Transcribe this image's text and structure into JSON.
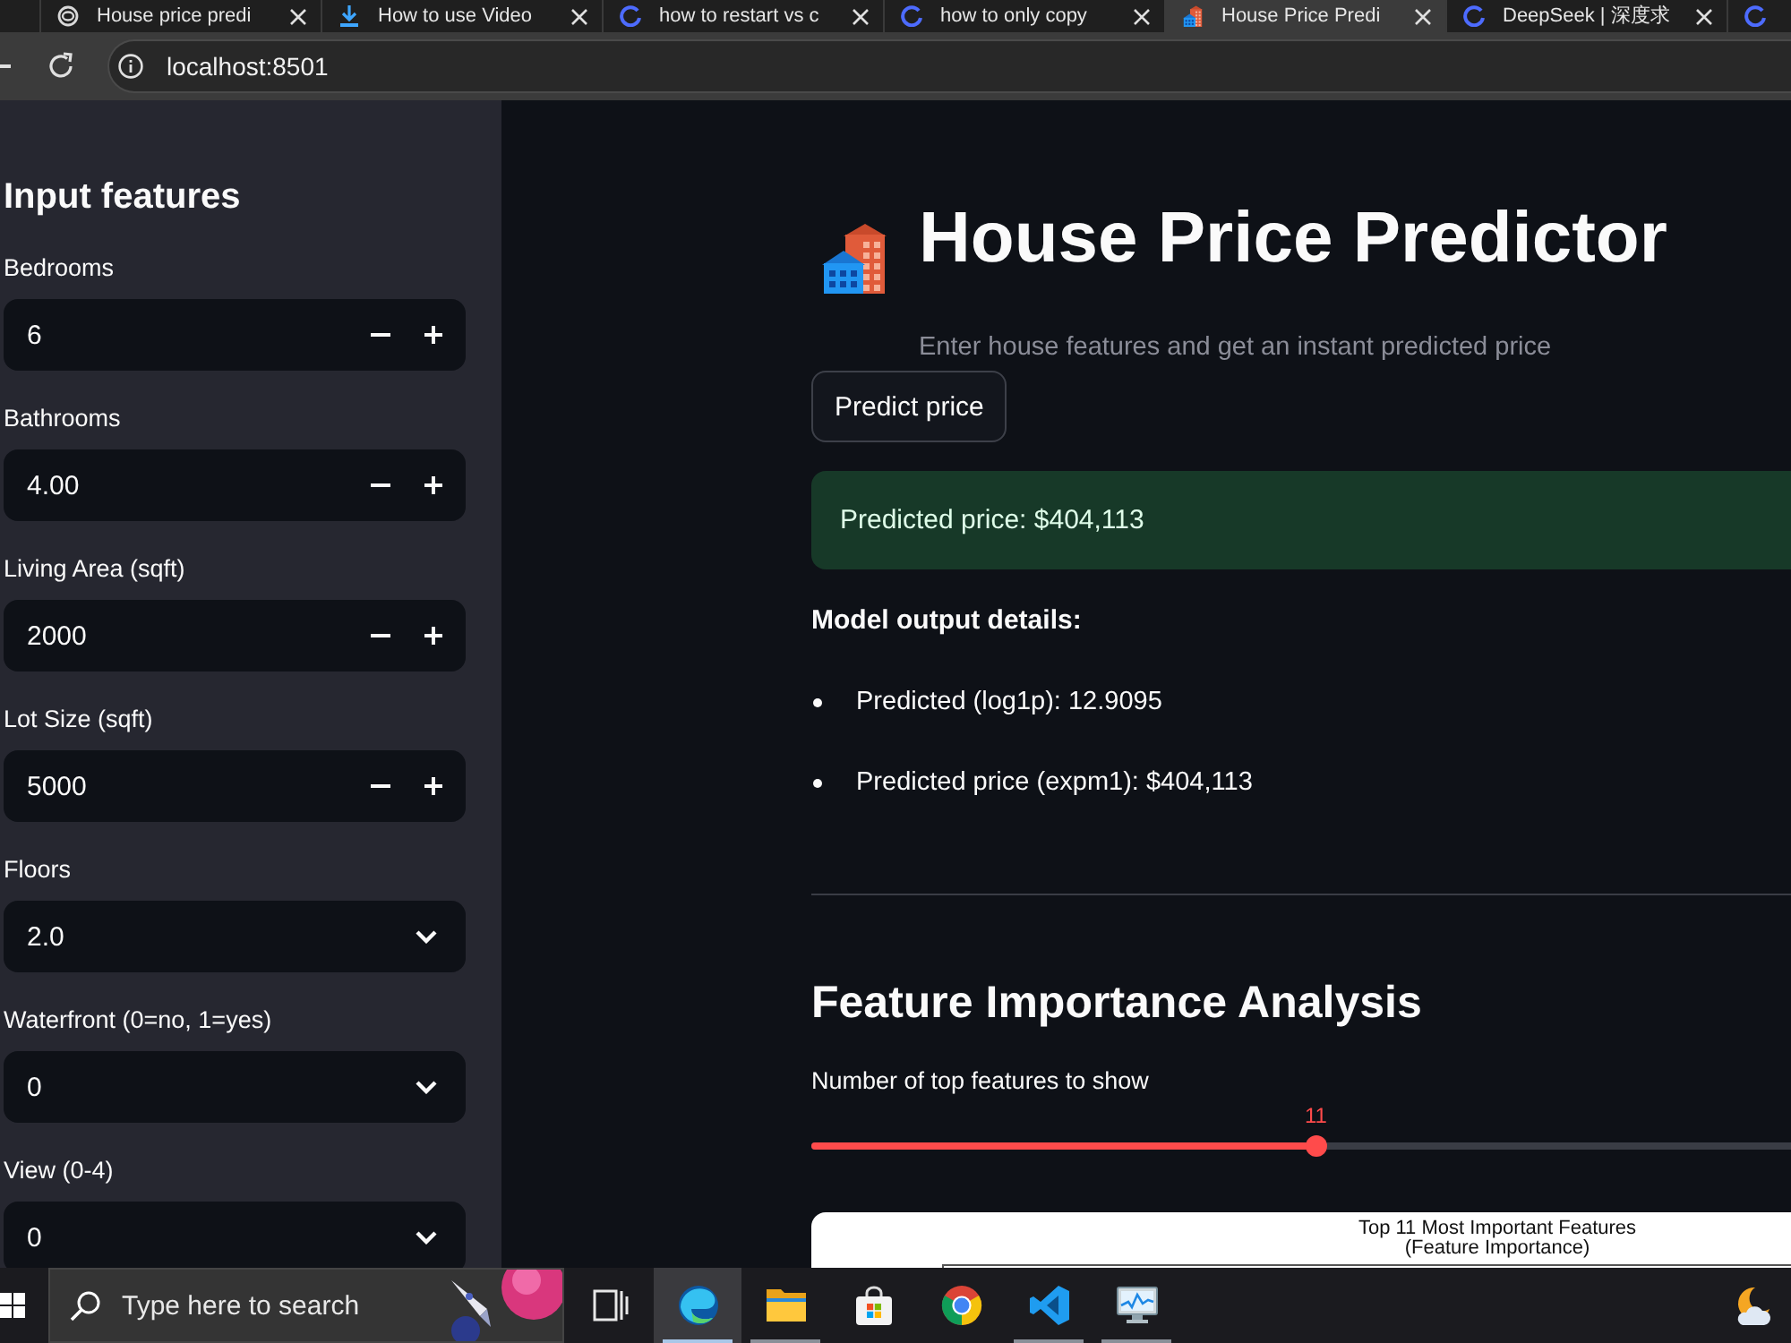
{
  "browser": {
    "tabs": [
      {
        "kind": "swirl",
        "title": "House price predi",
        "selected": false
      },
      {
        "kind": "download",
        "title": "How to use Video",
        "selected": false
      },
      {
        "kind": "ring",
        "title": "how to restart vs c",
        "selected": false
      },
      {
        "kind": "ring",
        "title": "how to only copy",
        "selected": false
      },
      {
        "kind": "buildings",
        "title": "House Price Predi",
        "selected": true
      },
      {
        "kind": "ring",
        "title": "DeepSeek | 深度求",
        "selected": false
      },
      {
        "kind": "ring",
        "selected": false
      }
    ],
    "address": "localhost:8501"
  },
  "sidebar": {
    "title": "Input features",
    "fields": [
      {
        "kind": "number",
        "label": "Bedrooms",
        "value": "6"
      },
      {
        "kind": "number",
        "label": "Bathrooms",
        "value": "4.00"
      },
      {
        "kind": "number",
        "label": "Living Area (sqft)",
        "value": "2000"
      },
      {
        "kind": "number",
        "label": "Lot Size (sqft)",
        "value": "5000"
      },
      {
        "kind": "select",
        "label": "Floors",
        "value": "2.0"
      },
      {
        "kind": "select",
        "label": "Waterfront (0=no, 1=yes)",
        "value": "0"
      },
      {
        "kind": "select",
        "label": "View (0-4)",
        "value": "0"
      }
    ]
  },
  "main": {
    "title": "House Price Predictor",
    "subtitle": "Enter house features and get an instant predicted price",
    "button": "Predict price",
    "result": {
      "kind": "success",
      "text": "Predicted price: $404,113"
    },
    "details": {
      "heading": "Model output details:",
      "items": [
        "Predicted (log1p): 12.9095",
        "Predicted price (expm1): $404,113"
      ]
    },
    "section": {
      "heading": "Feature Importance Analysis",
      "slider": {
        "label": "Number of top features to show",
        "value": "11",
        "level": 0.515
      },
      "chart": {
        "title_lines": [
          "Top 11 Most Important Features",
          "(Feature Importance)"
        ]
      }
    }
  },
  "taskbar": {
    "search": {
      "placeholder": "Type here to search"
    },
    "apps": [
      {
        "kind": "task_view",
        "active": false,
        "open": false
      },
      {
        "kind": "edge",
        "active": true,
        "open": true
      },
      {
        "kind": "explorer",
        "active": false,
        "open": true
      },
      {
        "kind": "store",
        "active": false,
        "open": false
      },
      {
        "kind": "chrome",
        "active": false,
        "open": false
      },
      {
        "kind": "vscode",
        "active": false,
        "open": true
      },
      {
        "kind": "monitor",
        "active": false,
        "open": true
      }
    ]
  }
}
